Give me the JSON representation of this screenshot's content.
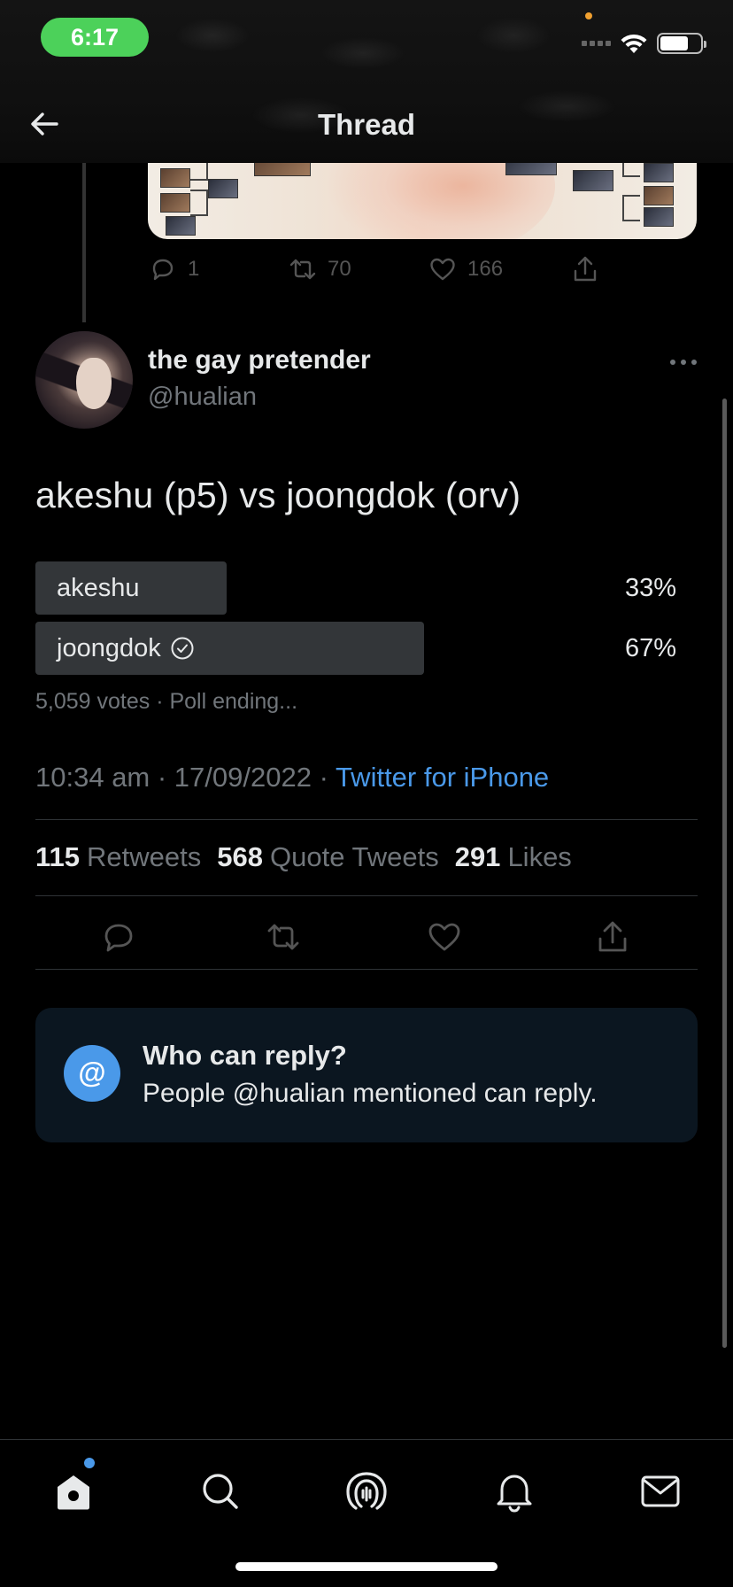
{
  "status_bar": {
    "time": "6:17"
  },
  "header": {
    "title": "Thread",
    "back_icon": "arrow-left-icon"
  },
  "previous_tweet": {
    "reply_count": "1",
    "retweet_count": "70",
    "like_count": "166"
  },
  "tweet": {
    "display_name": "the gay pretender",
    "handle": "@hualian",
    "text": "akeshu (p5) vs joongdok (orv)",
    "poll": {
      "options": [
        {
          "label": "akeshu",
          "percent": "33%",
          "fraction": 0.33,
          "winner": false
        },
        {
          "label": "joongdok",
          "percent": "67%",
          "fraction": 0.67,
          "winner": true
        }
      ],
      "meta": "5,059 votes · Poll ending..."
    },
    "time": "10:34 am · 17/09/2022 · ",
    "source": "Twitter for iPhone",
    "stats": {
      "retweets_count": "115",
      "retweets_label": "Retweets",
      "quotes_count": "568",
      "quotes_label": "Quote Tweets",
      "likes_count": "291",
      "likes_label": "Likes"
    }
  },
  "reply_restriction": {
    "badge": "@",
    "title": "Who can reply?",
    "subtitle": "People @hualian mentioned can reply."
  },
  "bottom_nav": {
    "items": [
      "home-icon",
      "search-icon",
      "spaces-icon",
      "notifications-icon",
      "messages-icon"
    ]
  },
  "colors": {
    "accent": "#4a99e9",
    "background": "#000000",
    "muted": "#71767b",
    "status_green": "#4cd15a"
  }
}
